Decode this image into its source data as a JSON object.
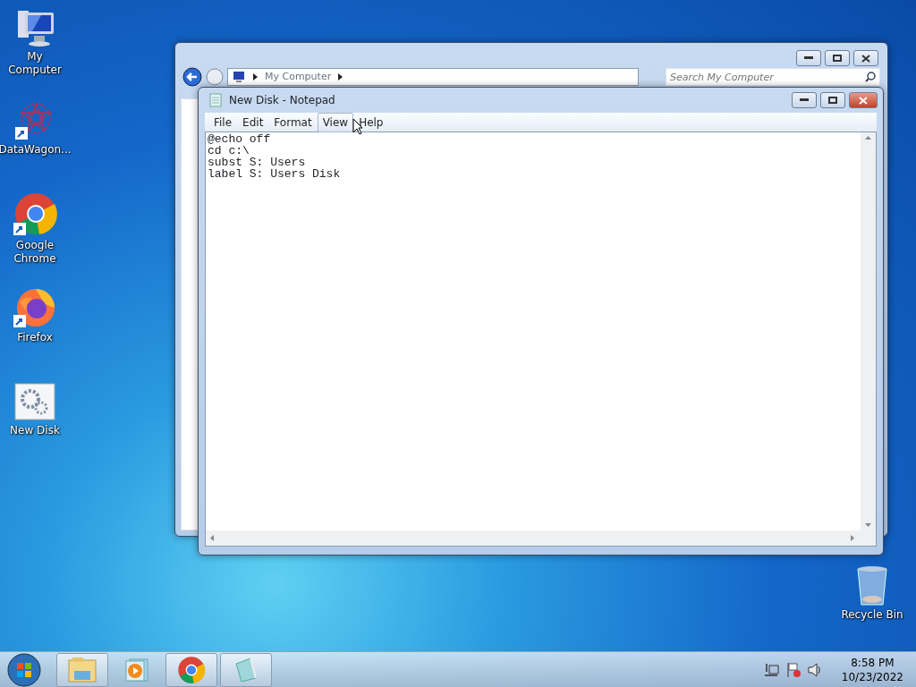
{
  "desktop_icons": [
    {
      "label": "My Computer",
      "kind": "computer",
      "shortcut": false
    },
    {
      "label": "DataWagon...",
      "kind": "star",
      "shortcut": true
    },
    {
      "label": "Google Chrome",
      "kind": "chrome",
      "shortcut": true
    },
    {
      "label": "Firefox",
      "kind": "firefox",
      "shortcut": true
    },
    {
      "label": "New Disk",
      "kind": "script",
      "shortcut": false
    }
  ],
  "recycle_bin": {
    "label": "Recycle Bin"
  },
  "explorer_window": {
    "address": [
      "My Computer"
    ],
    "search": {
      "placeholder": "Search My Computer"
    }
  },
  "notepad_window": {
    "title": "New Disk - Notepad",
    "menu": [
      {
        "label": "File",
        "selected": false
      },
      {
        "label": "Edit",
        "selected": false
      },
      {
        "label": "Format",
        "selected": false
      },
      {
        "label": "View",
        "selected": true
      },
      {
        "label": "Help",
        "selected": false
      }
    ],
    "text": "@echo off\ncd c:\\\nsubst S: Users\nlabel S: Users Disk"
  },
  "taskbar": {
    "items": [
      {
        "kind": "explorer",
        "running": true
      },
      {
        "kind": "media",
        "running": false
      },
      {
        "kind": "chrome",
        "running": true
      },
      {
        "kind": "notepad",
        "running": true
      }
    ],
    "time": "8:58 PM",
    "date": "10/23/2022"
  }
}
